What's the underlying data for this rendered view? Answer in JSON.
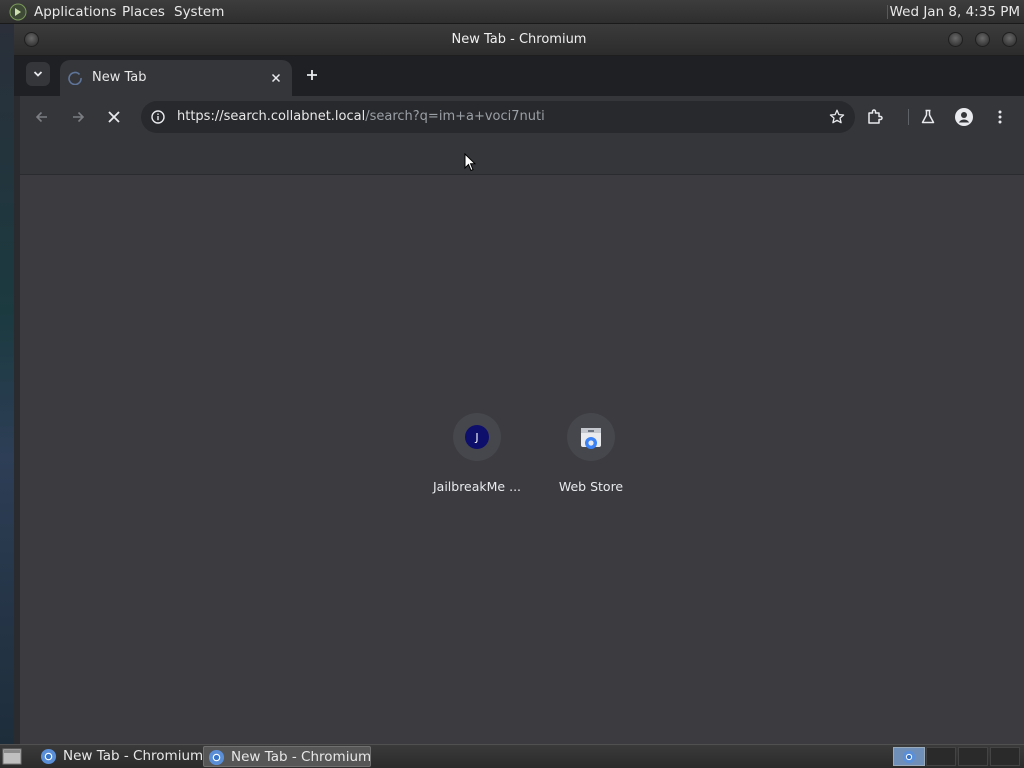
{
  "top_panel": {
    "menus": [
      "Applications",
      "Places",
      "System"
    ],
    "clock": "Wed Jan  8,  4:35 PM"
  },
  "window": {
    "title": "New Tab - Chromium"
  },
  "tabs": [
    {
      "title": "New Tab",
      "loading": true
    }
  ],
  "omnibox": {
    "url_host": "https://search.collabnet.local",
    "url_path": "/search?q=im+a+voci7nuti"
  },
  "shortcuts": [
    {
      "label": "JailbreakMe ...",
      "icon_letter": "J",
      "icon": "letter-favicon"
    },
    {
      "label": "Web Store",
      "icon": "web-store-icon"
    }
  ],
  "taskbar": {
    "items": [
      {
        "label": "New Tab - Chromium",
        "active": false
      },
      {
        "label": "New Tab - Chromium",
        "active": true
      }
    ]
  },
  "colors": {
    "content_bg": "#3b3b40",
    "toolbar_bg": "#35363a",
    "tabstrip_bg": "#1f2023",
    "favicon_j": "#0d0f6b"
  }
}
